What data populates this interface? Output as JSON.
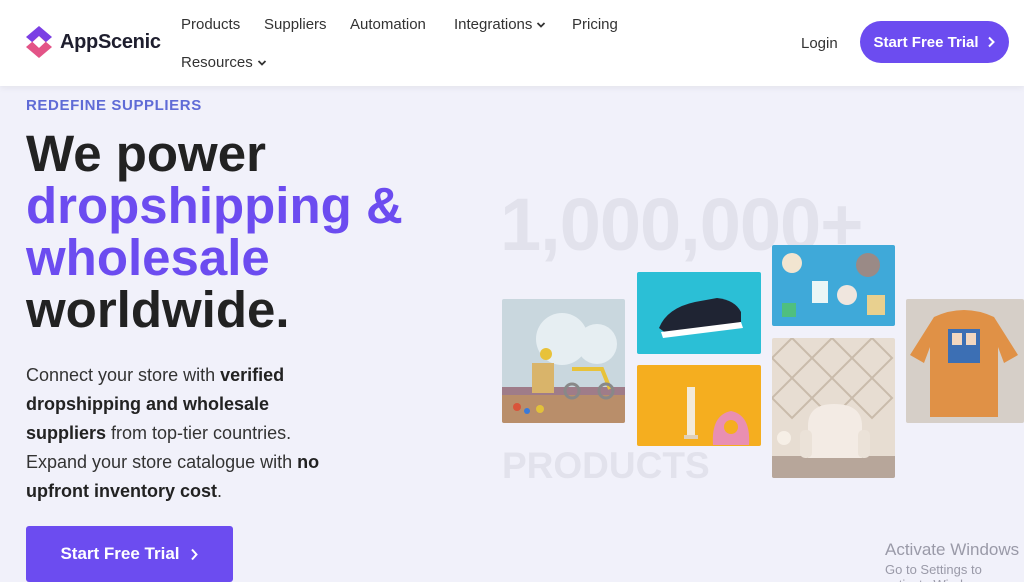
{
  "brand": {
    "name": "AppScenic"
  },
  "nav": {
    "products": "Products",
    "suppliers": "Suppliers",
    "automation": "Automation",
    "integrations": "Integrations",
    "pricing": "Pricing",
    "resources": "Resources",
    "login": "Login",
    "trial": "Start Free Trial"
  },
  "hero": {
    "eyebrow": "REDEFINE SUPPLIERS",
    "line1": "We power",
    "line2": "dropshipping &",
    "line3": "wholesale",
    "line4": "worldwide.",
    "desc": {
      "p1": "Connect your store with ",
      "b1": "verified dropshipping and wholesale suppliers",
      "p2": " from top-tier countries. Expand your store catalogue with ",
      "b2": "no upfront inventory cost",
      "p3": "."
    },
    "cta": "Start Free Trial"
  },
  "visual": {
    "count": "1,000,000+",
    "label": "PRODUCTS"
  },
  "watermark": {
    "line1": "Activate Windows",
    "line2": "Go to Settings to activate Windows."
  }
}
